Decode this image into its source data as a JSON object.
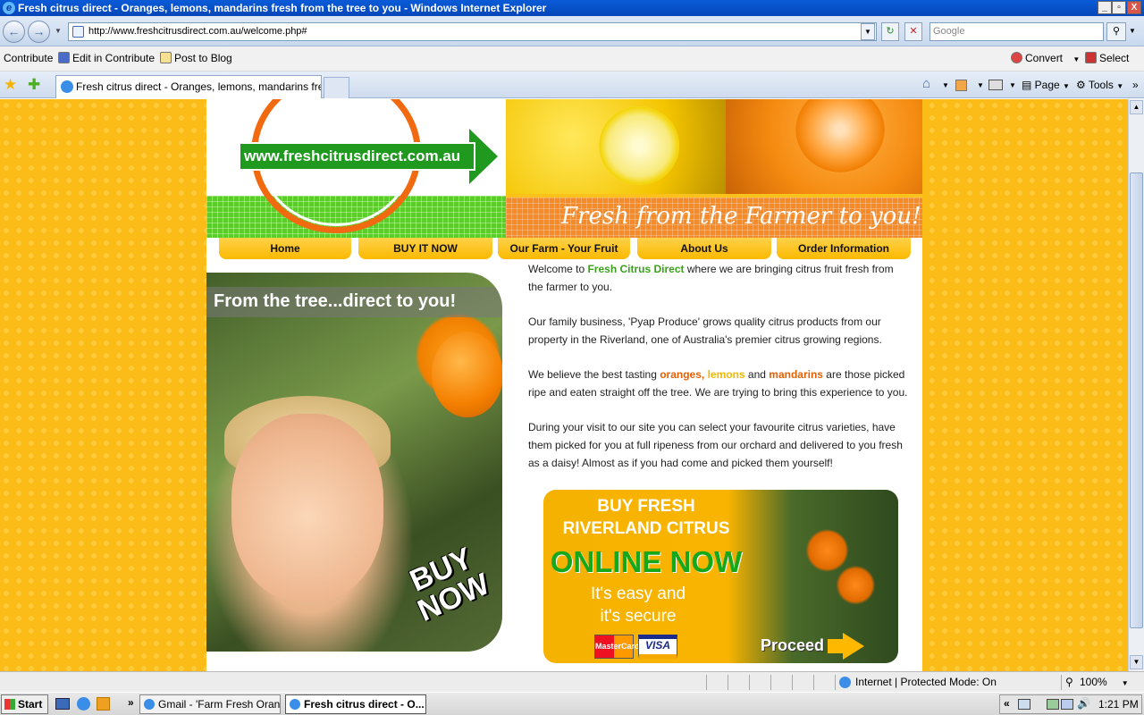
{
  "window": {
    "title": "Fresh citrus direct - Oranges, lemons, mandarins fresh from the tree to you - Windows Internet Explorer",
    "min": "_",
    "max": "▫",
    "close": "X"
  },
  "navbar": {
    "back": "←",
    "forward": "→",
    "url": "http://www.freshcitrusdirect.com.au/welcome.php#",
    "search_placeholder": "Google",
    "refresh": "↻",
    "stop": "✕",
    "search_go": "⚲"
  },
  "links": {
    "contribute": "Contribute",
    "edit_contribute": "Edit in Contribute",
    "post_blog": "Post to Blog",
    "convert": "Convert",
    "select": "Select"
  },
  "tabs": {
    "active_tab": "Fresh citrus direct - Oranges, lemons, mandarins fres...",
    "page": "Page",
    "tools": "Tools"
  },
  "site": {
    "url_banner": "www.freshcitrusdirect.com.au",
    "tagline": "Fresh from the Farmer to you!",
    "nav": [
      "Home",
      "BUY IT NOW",
      "Our Farm - Your Fruit",
      "About Us",
      "Order Information"
    ],
    "promo_caption": "From the tree...direct to you!",
    "promo_buy_1": "BUY",
    "promo_buy_2": "NOW",
    "content": {
      "p1_a": "Welcome to ",
      "p1_brand": "Fresh Citrus Direct",
      "p1_b": " where we are bringing citrus fruit fresh from the farmer to you.",
      "p2": "Our family business, 'Pyap Produce' grows quality citrus products from our property in the Riverland, one of Australia's premier citrus growing regions.",
      "p3_a": "We believe the best tasting ",
      "p3_oranges": "oranges",
      "p3_comma": ", ",
      "p3_lemons": "lemons",
      "p3_and": " and ",
      "p3_mandarins": "mandarins",
      "p3_b": " are those picked ripe and eaten straight off the tree. We are trying to bring this experience to you.",
      "p4": "During your visit to our site you can select your favourite citrus varieties, have them picked for you at full ripeness from our orchard and delivered to you fresh as a daisy! Almost as if you had come and picked them yourself!"
    },
    "banner": {
      "line1": "BUY FRESH",
      "line2": "RIVERLAND CITRUS",
      "line3": "ONLINE NOW",
      "line4": "It's easy and",
      "line5": "it's secure",
      "mastercard": "MasterCard",
      "visa": "VISA",
      "proceed": "Proceed"
    }
  },
  "status": {
    "zone": "Internet | Protected Mode: On",
    "zoom": "100%"
  },
  "taskbar": {
    "start": "Start",
    "chevron": "»",
    "task1": "Gmail - 'Farm Fresh Oran...",
    "task2": "Fresh citrus direct - O...",
    "tray_chevron": "«",
    "time": "1:21 PM"
  }
}
